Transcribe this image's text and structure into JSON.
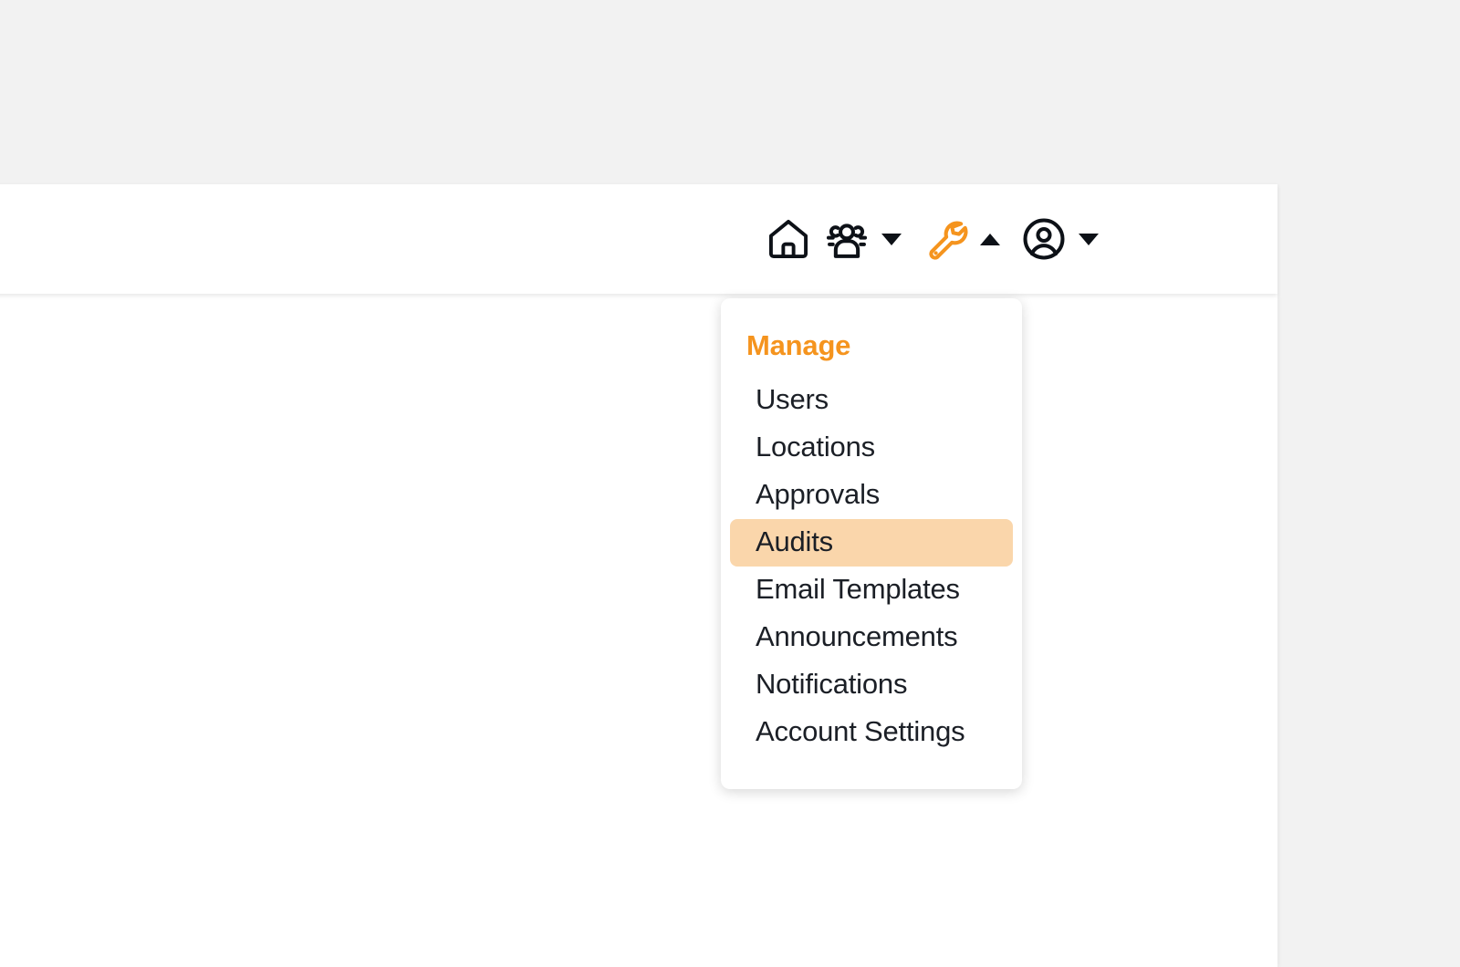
{
  "header": {
    "nav_items": [
      {
        "name": "home",
        "icon": "home-icon",
        "label": "Home",
        "has_caret": false,
        "caret": "",
        "color": "#0d1117"
      },
      {
        "name": "people",
        "icon": "people-group-icon",
        "label": "People",
        "has_caret": true,
        "caret": "down",
        "color": "#0d1117"
      },
      {
        "name": "tools",
        "icon": "wrench-icon",
        "label": "Manage",
        "has_caret": true,
        "caret": "up",
        "color": "#f5941e"
      },
      {
        "name": "account",
        "icon": "user-circle-icon",
        "label": "Account",
        "has_caret": true,
        "caret": "down",
        "color": "#0d1117"
      }
    ]
  },
  "dropdown": {
    "heading": "Manage",
    "items": [
      {
        "label": "Users",
        "active": false
      },
      {
        "label": "Locations",
        "active": false
      },
      {
        "label": "Approvals",
        "active": false
      },
      {
        "label": "Audits",
        "active": true
      },
      {
        "label": "Email Templates",
        "active": false
      },
      {
        "label": "Announcements",
        "active": false
      },
      {
        "label": "Notifications",
        "active": false
      },
      {
        "label": "Account Settings",
        "active": false
      }
    ]
  },
  "colors": {
    "accent_orange": "#f5941e",
    "highlight_peach": "#fad6ab",
    "text_dark": "#1b1f26",
    "page_background": "#f2f2f2",
    "panel_background": "#ffffff"
  }
}
